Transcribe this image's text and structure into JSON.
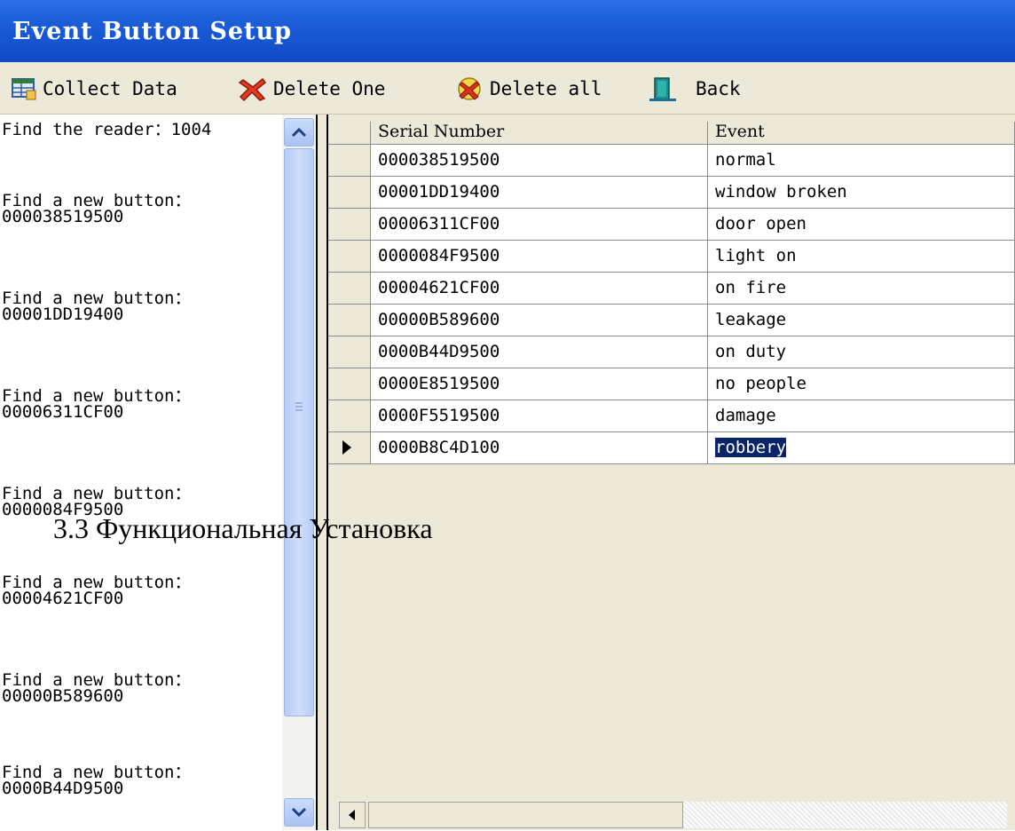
{
  "window": {
    "title": "Event Button Setup"
  },
  "toolbar": {
    "collect_label": "Collect Data",
    "delete_one_label": "Delete One",
    "delete_all_label": "Delete all",
    "back_label": "Back"
  },
  "log": {
    "reader_line": "Find the reader：1004",
    "entries": [
      {
        "label": "Find a new button：",
        "serial": "000038519500"
      },
      {
        "label": "Find a new button：",
        "serial": "00001DD19400"
      },
      {
        "label": "Find a new button：",
        "serial": "00006311CF00"
      },
      {
        "label": "Find a new button：",
        "serial": "0000084F9500"
      },
      {
        "label": "Find a new button：",
        "serial": "00004621CF00"
      },
      {
        "label": "Find a new button：",
        "serial": "00000B589600"
      },
      {
        "label": "Find a new button：",
        "serial": "0000B44D9500"
      }
    ]
  },
  "grid": {
    "columns": [
      "Serial Number",
      "Event"
    ],
    "rows": [
      {
        "serial": "000038519500",
        "event": "normal"
      },
      {
        "serial": "00001DD19400",
        "event": "window broken"
      },
      {
        "serial": "00006311CF00",
        "event": "door open"
      },
      {
        "serial": "0000084F9500",
        "event": "light on"
      },
      {
        "serial": "00004621CF00",
        "event": "on fire"
      },
      {
        "serial": "00000B589600",
        "event": "leakage"
      },
      {
        "serial": "0000B44D9500",
        "event": "on duty"
      },
      {
        "serial": "0000E8519500",
        "event": "no people"
      },
      {
        "serial": "0000F5519500",
        "event": "damage"
      },
      {
        "serial": "0000B8C4D100",
        "event": "robbery"
      }
    ],
    "current_row_index": 9
  },
  "caption": "3.3 Функциональная Установка",
  "colors": {
    "titlebar": "#1d5fd9",
    "selection": "#0a246a",
    "face": "#ece9d8"
  },
  "icons": [
    "collect-data-icon",
    "delete-one-icon",
    "delete-all-icon",
    "back-icon",
    "scroll-up-icon",
    "scroll-down-icon",
    "scroll-left-icon",
    "row-pointer-icon"
  ]
}
